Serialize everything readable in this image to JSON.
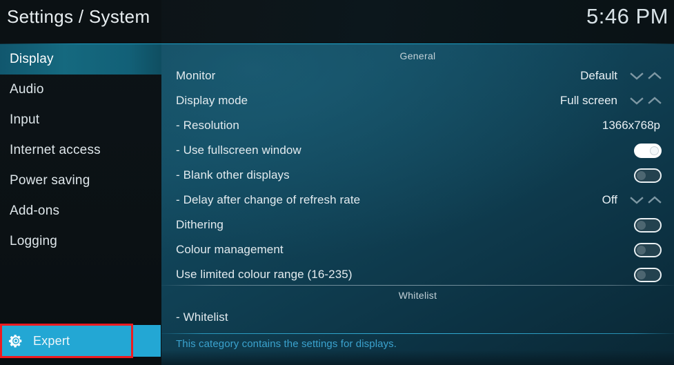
{
  "header": {
    "title": "Settings / System",
    "clock": "5:46 PM"
  },
  "sidebar": {
    "items": [
      {
        "label": "Display",
        "selected": true
      },
      {
        "label": "Audio",
        "selected": false
      },
      {
        "label": "Input",
        "selected": false
      },
      {
        "label": "Internet access",
        "selected": false
      },
      {
        "label": "Power saving",
        "selected": false
      },
      {
        "label": "Add-ons",
        "selected": false
      },
      {
        "label": "Logging",
        "selected": false
      }
    ],
    "level_button": {
      "label": "Expert",
      "icon": "gear-icon",
      "highlight_color": "#ee1b20",
      "background_color": "#23a7d4"
    }
  },
  "content": {
    "sections": [
      {
        "title": "General",
        "rows": [
          {
            "label": "Monitor",
            "value": "Default",
            "control": "spinner"
          },
          {
            "label": "Display mode",
            "value": "Full screen",
            "control": "spinner"
          },
          {
            "label": "- Resolution",
            "value": "1366x768p",
            "control": "text"
          },
          {
            "label": "- Use fullscreen window",
            "value": "On",
            "control": "toggle"
          },
          {
            "label": "- Blank other displays",
            "value": "Off",
            "control": "toggle"
          },
          {
            "label": "- Delay after change of refresh rate",
            "value": "Off",
            "control": "spinner"
          },
          {
            "label": "Dithering",
            "value": "Off",
            "control": "toggle"
          },
          {
            "label": "Colour management",
            "value": "Off",
            "control": "toggle"
          },
          {
            "label": "Use limited colour range (16-235)",
            "value": "Off",
            "control": "toggle"
          }
        ]
      },
      {
        "title": "Whitelist",
        "rows": [
          {
            "label": "- Whitelist",
            "value": "",
            "control": "none"
          }
        ]
      }
    ],
    "description": "This category contains the settings for displays."
  },
  "colors": {
    "accent_cyan": "#23a7d4",
    "selection_teal": "#15697f",
    "highlight_red": "#ee1b20",
    "content_teal": "#11455a",
    "footer_text": "#3ba3cf"
  }
}
